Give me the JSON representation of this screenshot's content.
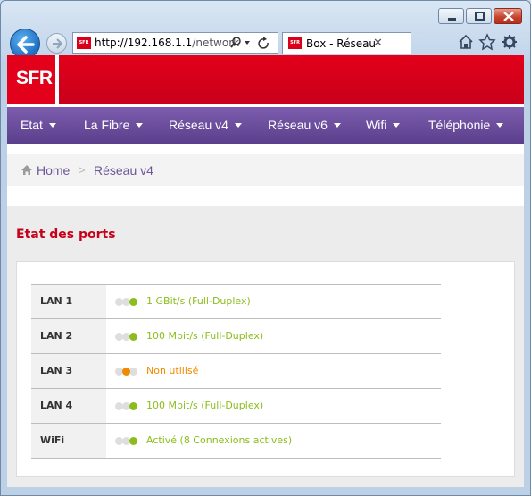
{
  "browser": {
    "url_host": "http://192.168.1.1",
    "url_path": "/network",
    "tab_title": "Box - Réseau",
    "tab_favicon_text": "SFR"
  },
  "brand": {
    "logo_text": "SFR",
    "red": "#e2001a",
    "purple": "#6a4c9c"
  },
  "nav": {
    "items": [
      {
        "label": "Etat"
      },
      {
        "label": "La Fibre"
      },
      {
        "label": "Réseau v4"
      },
      {
        "label": "Réseau v6"
      },
      {
        "label": "Wifi"
      },
      {
        "label": "Téléphonie"
      }
    ]
  },
  "breadcrumb": {
    "home": "Home",
    "separator": ">",
    "current": "Réseau v4"
  },
  "section": {
    "title": "Etat des ports"
  },
  "ports": [
    {
      "name": "LAN 1",
      "status": "1 GBit/s (Full-Duplex)",
      "level": 3,
      "color": "#8cbd1d"
    },
    {
      "name": "LAN 2",
      "status": "100 Mbit/s (Full-Duplex)",
      "level": 3,
      "color": "#8cbd1d"
    },
    {
      "name": "LAN 3",
      "status": "Non utilisé",
      "level": 2,
      "color": "#f08a00"
    },
    {
      "name": "LAN 4",
      "status": "100 Mbit/s (Full-Duplex)",
      "level": 3,
      "color": "#8cbd1d"
    },
    {
      "name": "WiFi",
      "status": "Activé (8 Connexions actives)",
      "level": 3,
      "color": "#8cbd1d"
    }
  ]
}
